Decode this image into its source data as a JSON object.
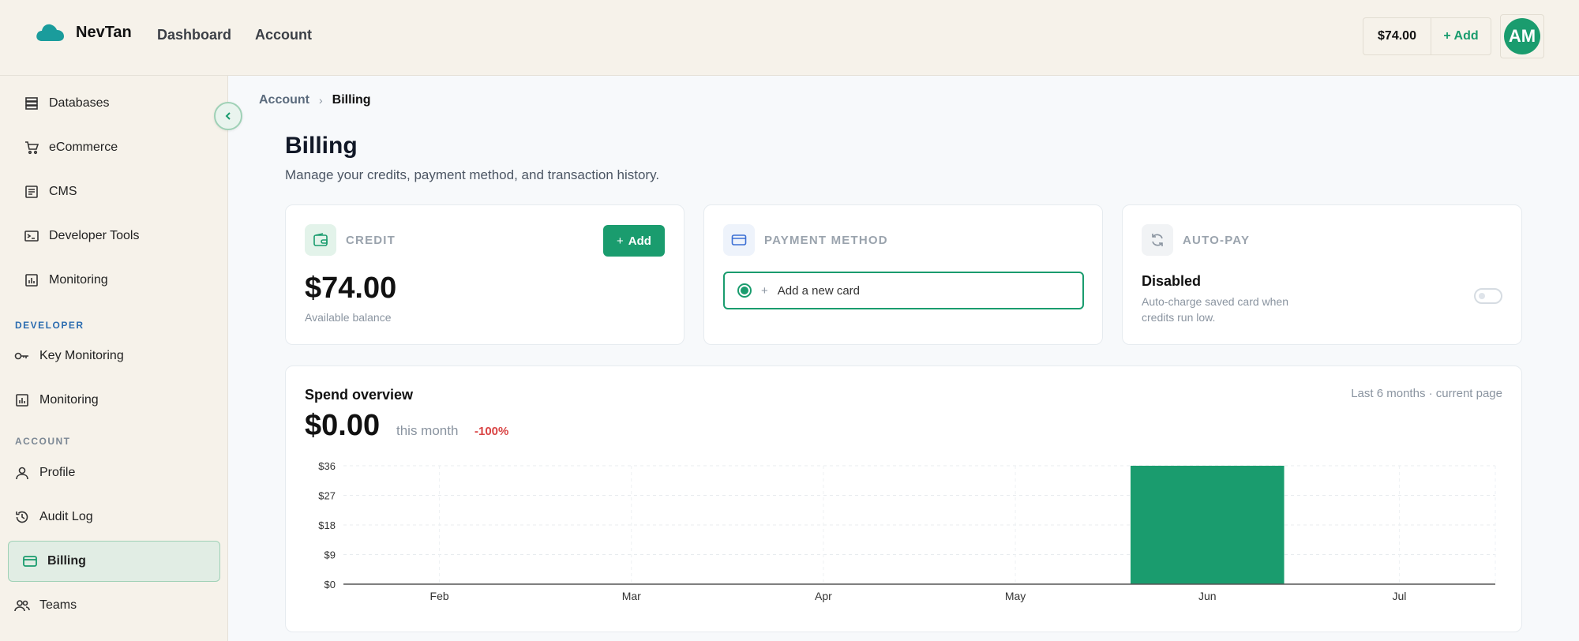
{
  "header": {
    "brand": "NevTan",
    "nav": [
      "Dashboard",
      "Account"
    ],
    "balance": "$74.00",
    "add_label": "+ Add",
    "avatar_initials": "AM"
  },
  "sidebar": {
    "items_top": [
      {
        "label": "Databases",
        "icon": "database-icon"
      },
      {
        "label": "eCommerce",
        "icon": "cart-icon"
      },
      {
        "label": "CMS",
        "icon": "document-icon"
      },
      {
        "label": "Developer Tools",
        "icon": "terminal-icon"
      },
      {
        "label": "Monitoring",
        "icon": "chart-icon"
      }
    ],
    "section_developer": "DEVELOPER",
    "items_developer": [
      {
        "label": "Key Monitoring",
        "icon": "key-icon"
      },
      {
        "label": "Monitoring",
        "icon": "chart-icon"
      }
    ],
    "section_account": "ACCOUNT",
    "items_account": [
      {
        "label": "Profile",
        "icon": "user-icon"
      },
      {
        "label": "Audit Log",
        "icon": "history-icon"
      },
      {
        "label": "Billing",
        "icon": "credit-card-icon",
        "active": true
      },
      {
        "label": "Teams",
        "icon": "users-icon"
      }
    ]
  },
  "breadcrumb": {
    "parent": "Account",
    "current": "Billing"
  },
  "page": {
    "title": "Billing",
    "subtitle": "Manage your credits, payment method, and transaction history."
  },
  "cards": {
    "credit": {
      "label": "CREDIT",
      "add_label": "Add",
      "amount": "$74.00",
      "sub": "Available balance"
    },
    "payment": {
      "label": "PAYMENT METHOD",
      "add_card": "Add a new card"
    },
    "autopay": {
      "label": "AUTO-PAY",
      "status": "Disabled",
      "desc": "Auto-charge saved card when credits run low.",
      "enabled": false
    }
  },
  "spend": {
    "title": "Spend overview",
    "range": "Last 6 months · current page",
    "amount": "$0.00",
    "period": "this month",
    "change": "-100%"
  },
  "colors": {
    "accent": "#1a9c6e",
    "negative": "#d94444",
    "header_bg": "#f6f2ea"
  },
  "chart_data": {
    "type": "bar",
    "categories": [
      "Feb",
      "Mar",
      "Apr",
      "May",
      "Jun",
      "Jul"
    ],
    "values": [
      0,
      0,
      0,
      0,
      36,
      0
    ],
    "ylim": [
      0,
      36
    ],
    "yticks": [
      "$0",
      "$9",
      "$18",
      "$27",
      "$36"
    ],
    "ytick_values": [
      0,
      9,
      18,
      27,
      36
    ],
    "grid": true
  }
}
